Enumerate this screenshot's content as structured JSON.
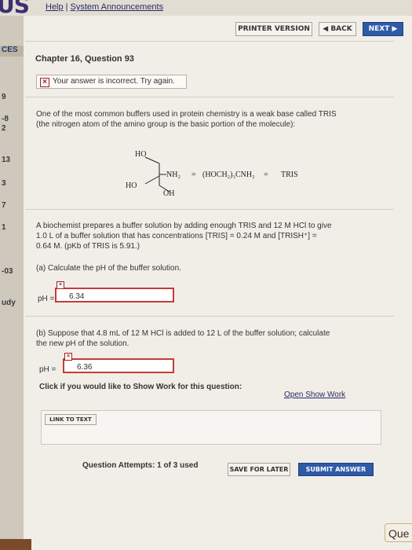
{
  "header": {
    "logo_text": "US",
    "links": [
      "Help",
      "System Announcements"
    ],
    "separator": "|"
  },
  "sidebar": {
    "section_label": "CES",
    "items": [
      "9",
      "-8",
      "2",
      "13",
      "3",
      "7",
      "1",
      "-03",
      "udy"
    ]
  },
  "nav": {
    "printer_label": "PRINTER VERSION",
    "back_label": "◀ BACK",
    "next_label": "NEXT ▶"
  },
  "question": {
    "title": "Chapter 16, Question 93",
    "status_text": "Your answer is incorrect.  Try again.",
    "intro_line1": "One of the most common buffers used in protein chemistry is a weak base called TRIS",
    "intro_line2": "(the nitrogen atom of the amino group is the basic portion of the molecule):",
    "structure": {
      "ho_top": "HO",
      "nh2": "NH₂",
      "eq1": "=",
      "formula": "(HOCH₂)₃CNH₂",
      "eq2": "=",
      "name": "TRIS",
      "ho_left": "HO",
      "oh": "OH"
    },
    "prob_line1": "A biochemist prepares a buffer solution by adding enough TRIS and 12 M HCl to give",
    "prob_line2": "1.0 L of a buffer solution that has concentrations [TRIS] = 0.24 M and [TRISH⁺] =",
    "prob_line3": "0.64 M. (pKb of TRIS is 5.91.)",
    "part_a": "(a) Calculate the pH of the buffer solution.",
    "part_a_label": "pH =",
    "part_a_value": "6.34",
    "part_b_line1": "(b) Suppose that 4.8 mL of 12 M HCl is added to 12 L of the buffer solution; calculate",
    "part_b_line2": "the new pH of the solution.",
    "part_b_label": "pH =",
    "part_b_value": "6.36",
    "show_work_text": "Click if you would like to Show Work for this question:",
    "show_work_link": "Open Show Work",
    "link_to_text": "LINK TO TEXT",
    "attempts": "Question Attempts: 1 of 3 used",
    "save_label": "SAVE FOR LATER",
    "submit_label": "SUBMIT ANSWER",
    "que_label": "Que"
  },
  "colors": {
    "error_red": "#c53c37",
    "submit_blue": "#2f5aa8",
    "link_blue": "#2a2a66"
  }
}
